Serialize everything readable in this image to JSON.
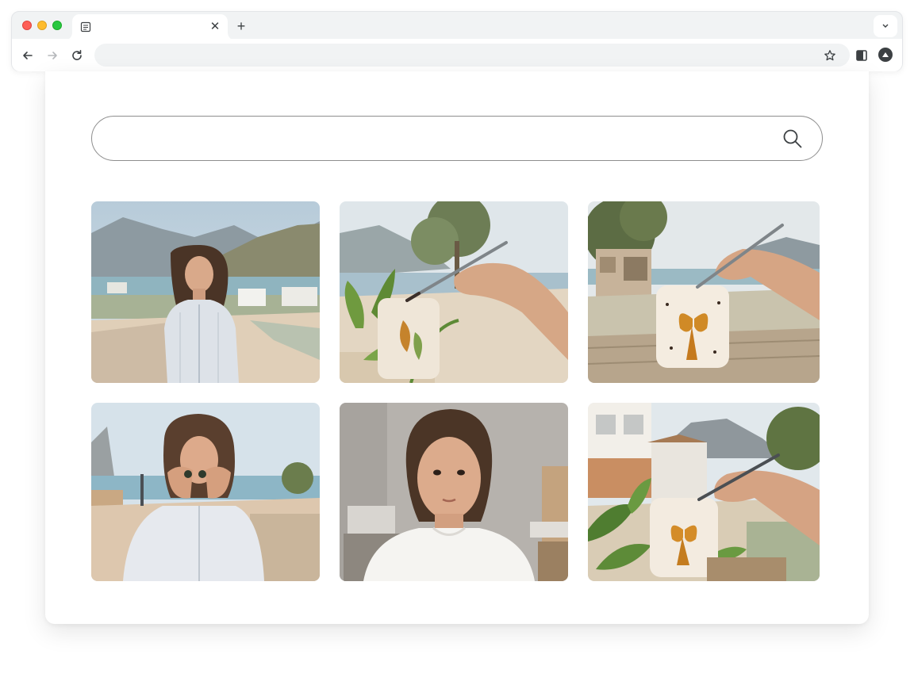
{
  "browser": {
    "tab": {
      "title": "",
      "favicon": "page-icon"
    },
    "url": "",
    "window_controls": [
      "close",
      "minimize",
      "maximize"
    ]
  },
  "search": {
    "placeholder": "",
    "value": "",
    "icon": "search-icon"
  },
  "gallery": {
    "images": [
      {
        "name": "woman-coastal-portrait"
      },
      {
        "name": "hand-painting-candle-with-leaves"
      },
      {
        "name": "hand-painting-candle-on-table"
      },
      {
        "name": "woman-holding-object-to-face"
      },
      {
        "name": "woman-indoor-portrait"
      },
      {
        "name": "hand-painting-candle-garden"
      }
    ]
  }
}
